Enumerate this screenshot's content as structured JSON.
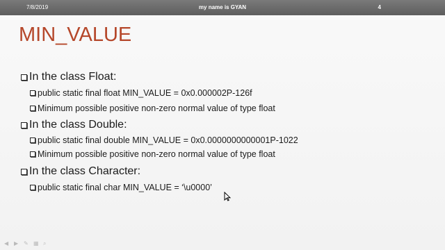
{
  "header": {
    "date": "7/8/2019",
    "title": "my name is GYAN",
    "page_number": "4"
  },
  "slide": {
    "title": "MIN_VALUE",
    "bullets": [
      {
        "text": "In the class Float:"
      },
      {
        "text": "public static final float MIN_VALUE = 0x0.000002P-126f"
      },
      {
        "text": "Minimum possible positive non-zero normal value of type float"
      },
      {
        "text": "In the class Double:"
      },
      {
        "text": "public static final double MIN_VALUE = 0x0.0000000000001P-1022"
      },
      {
        "text": "Minimum possible positive non-zero normal value of type float"
      },
      {
        "text": "In the class Character:"
      },
      {
        "text": "public static final char MIN_VALUE = ‘\\u0000’"
      }
    ]
  },
  "icons": {
    "bullet": "square-bullet-icon",
    "cursor": "mouse-pointer-icon",
    "toolbar": [
      "previous-icon",
      "next-icon",
      "pen-icon",
      "slides-icon",
      "search-icon"
    ]
  }
}
